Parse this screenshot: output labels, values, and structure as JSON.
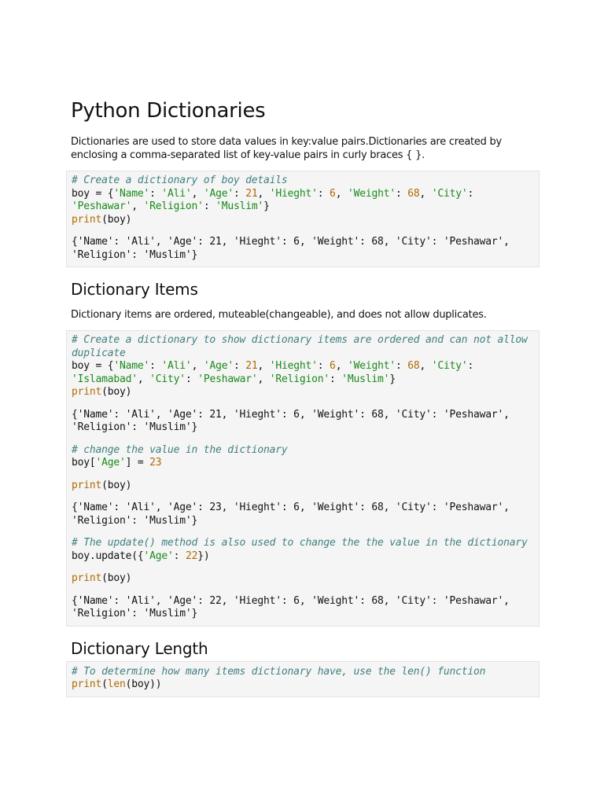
{
  "title": "Python Dictionaries",
  "intro": "Dictionaries are used to store data values in key:value pairs.Dictionaries are created by enclosing a comma-separated list of key-value pairs in curly braces { }.",
  "block1": {
    "comment": "# Create a dictionary of boy details",
    "output": "{'Name': 'Ali', 'Age': 21, 'Hieght': 6, 'Weight': 68, 'City': 'Peshawar', 'Religion': 'Muslim'}"
  },
  "section2": {
    "heading": "Dictionary Items",
    "text": "Dictionary items are ordered, muteable(changeable), and does not allow duplicates."
  },
  "block2": {
    "comment1": "# Create a dictionary to show dictionary items are ordered and can not allow duplicate",
    "output1": "{'Name': 'Ali', 'Age': 21, 'Hieght': 6, 'Weight': 68, 'City': 'Peshawar', 'Religion': 'Muslim'}",
    "comment2": "# change the value in the dictionary",
    "output2": "{'Name': 'Ali', 'Age': 23, 'Hieght': 6, 'Weight': 68, 'City': 'Peshawar', 'Religion': 'Muslim'}",
    "comment3": "# The update() method is also used to change the the value in the dictionary",
    "output3": "{'Name': 'Ali', 'Age': 22, 'Hieght': 6, 'Weight': 68, 'City': 'Peshawar', 'Religion': 'Muslim'}"
  },
  "section3": {
    "heading": "Dictionary Length"
  },
  "block3": {
    "comment": "# To determine how many items dictionary have, use the len() function"
  }
}
